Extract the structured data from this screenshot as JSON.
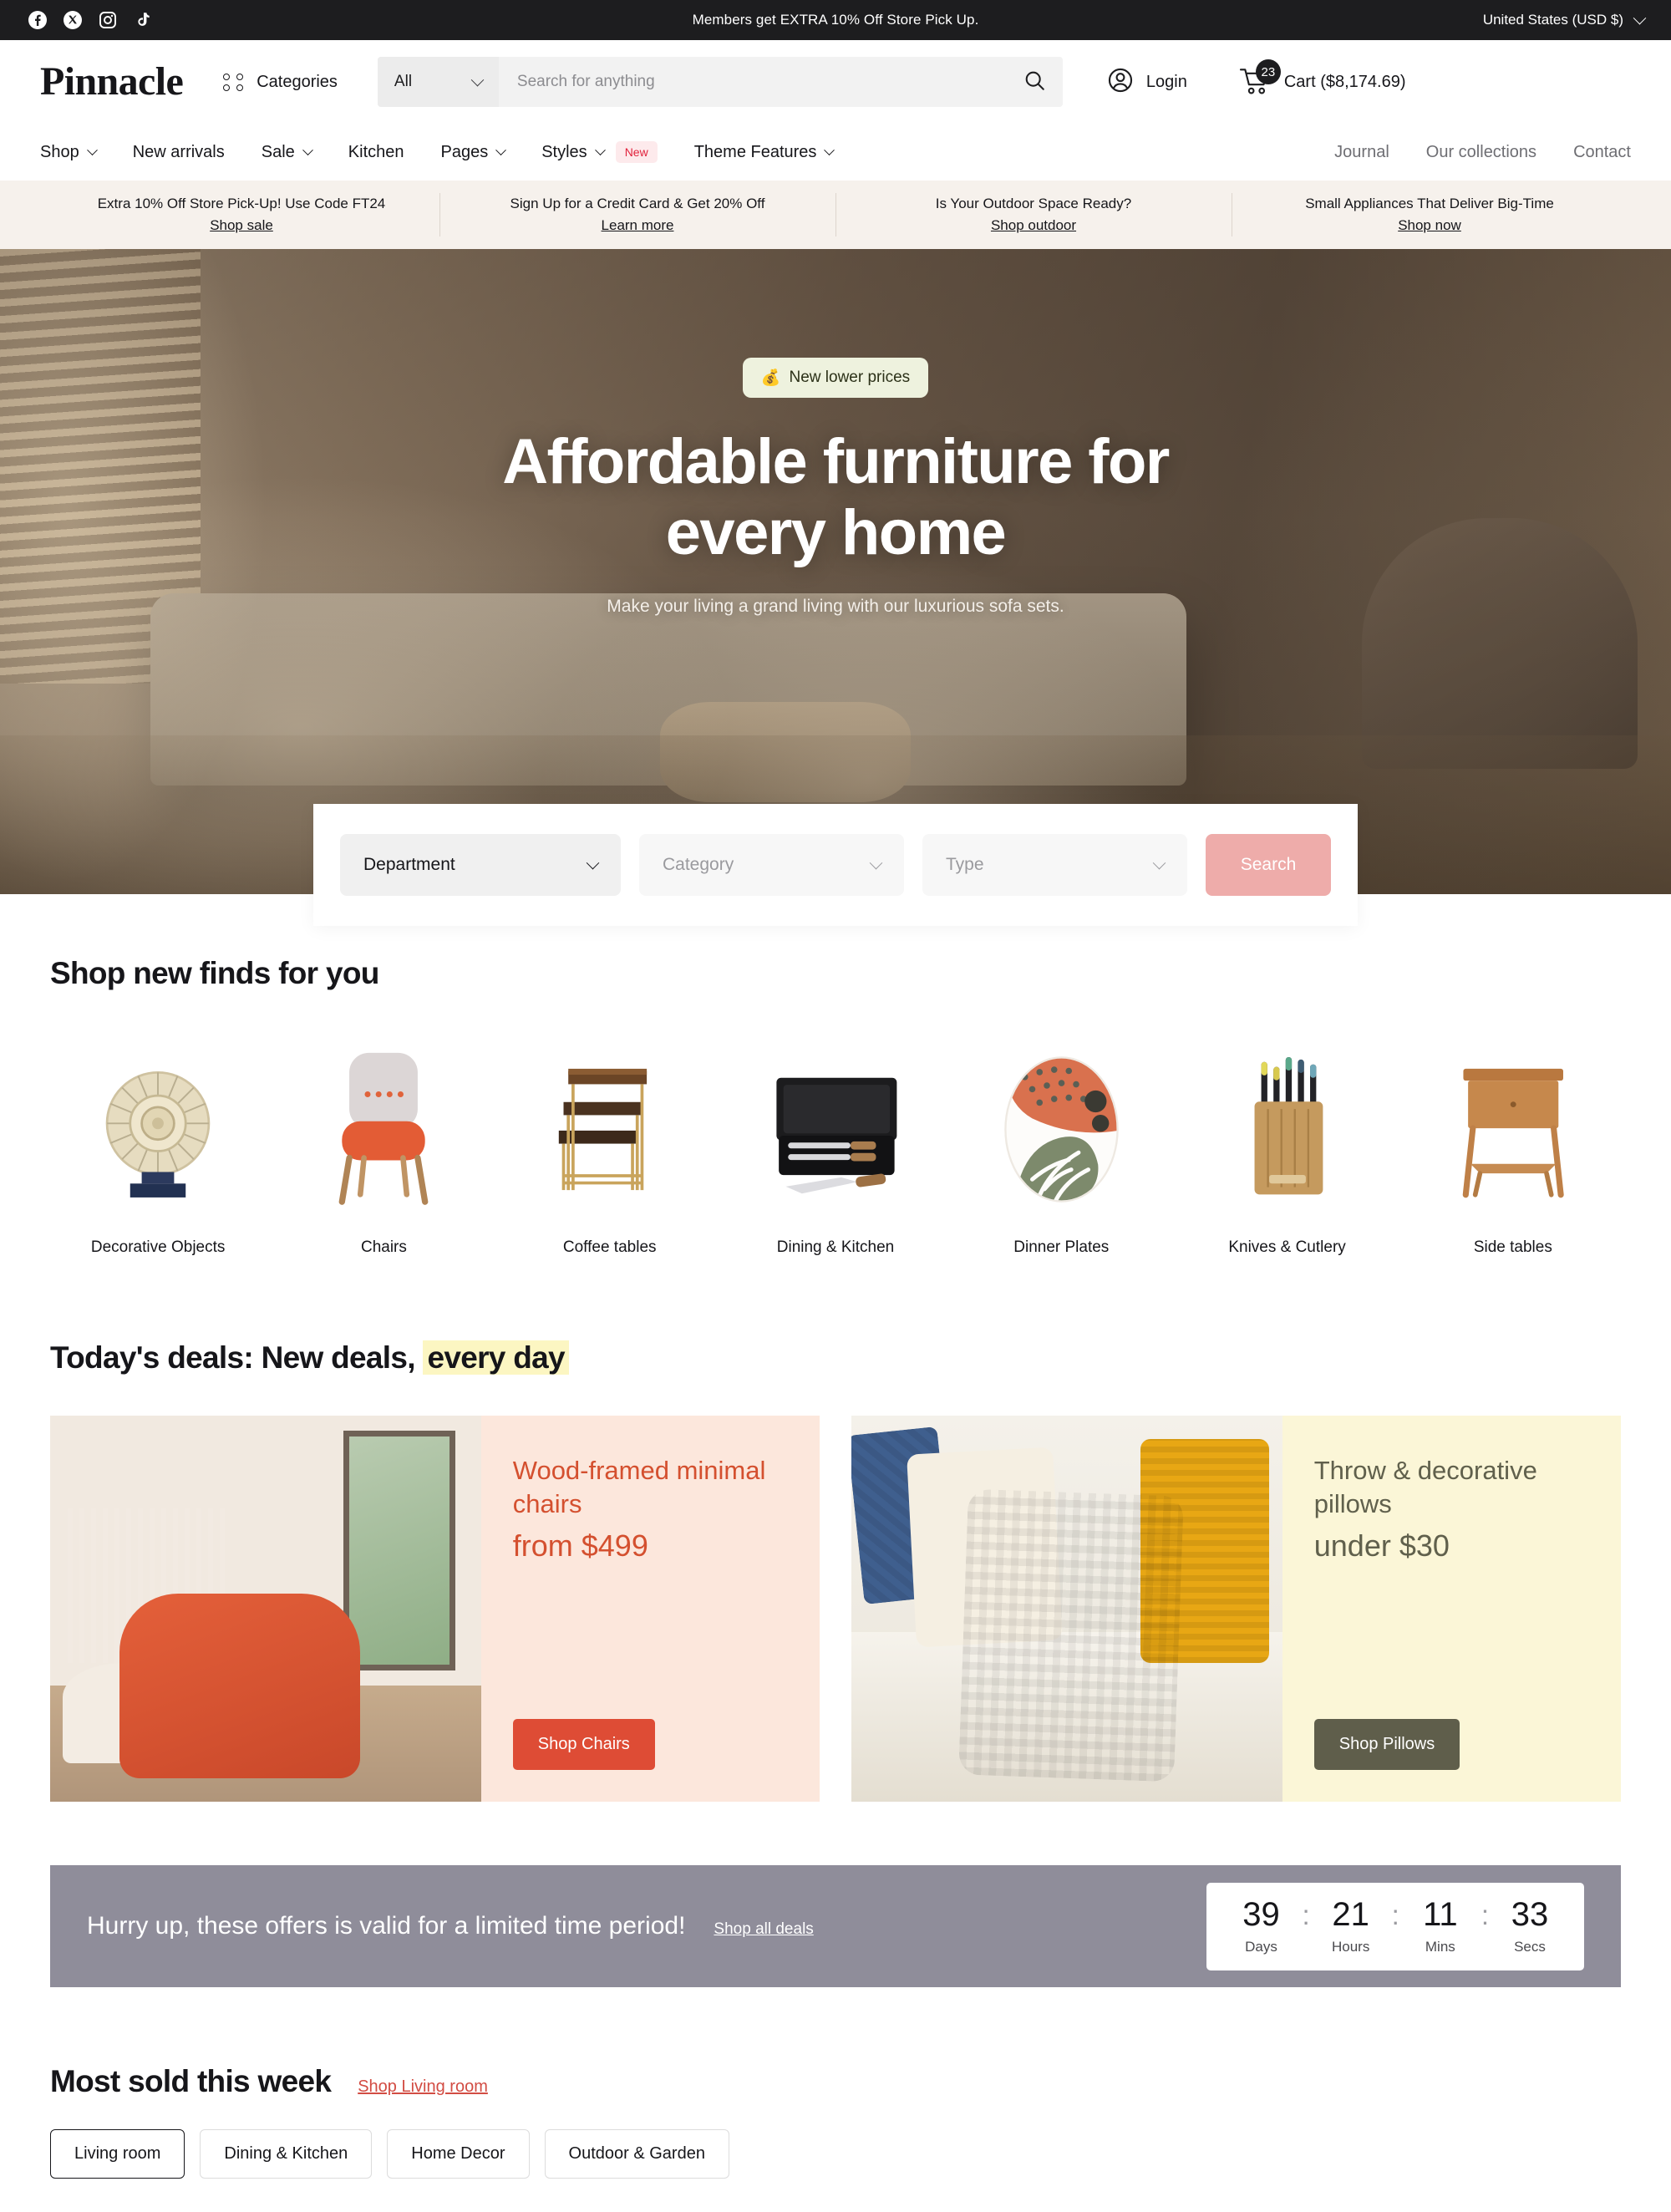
{
  "topbar": {
    "social": [
      {
        "name": "facebook-icon",
        "label": "Facebook"
      },
      {
        "name": "x-icon",
        "label": "X"
      },
      {
        "name": "instagram-icon",
        "label": "Instagram"
      },
      {
        "name": "tiktok-icon",
        "label": "TikTok"
      }
    ],
    "message": "Members get EXTRA 10% Off Store Pick Up.",
    "region": "United States (USD $)"
  },
  "header": {
    "logo": "Pinnacle",
    "categories_label": "Categories",
    "search": {
      "scope": "All",
      "placeholder": "Search for anything",
      "value": ""
    },
    "login_label": "Login",
    "cart_label": "Cart ($8,174.69)",
    "cart_count": "23"
  },
  "nav": {
    "left": [
      {
        "label": "Shop",
        "caret": true,
        "badge": ""
      },
      {
        "label": "New arrivals",
        "caret": false,
        "badge": ""
      },
      {
        "label": "Sale",
        "caret": true,
        "badge": ""
      },
      {
        "label": "Kitchen",
        "caret": false,
        "badge": ""
      },
      {
        "label": "Pages",
        "caret": true,
        "badge": ""
      },
      {
        "label": "Styles",
        "caret": true,
        "badge": "New"
      },
      {
        "label": "Theme Features",
        "caret": true,
        "badge": ""
      }
    ],
    "right": [
      {
        "label": "Journal"
      },
      {
        "label": "Our collections"
      },
      {
        "label": "Contact"
      }
    ]
  },
  "promos": [
    {
      "title": "Extra 10% Off Store Pick-Up! Use Code FT24",
      "link": "Shop sale"
    },
    {
      "title": "Sign Up for a Credit Card & Get 20% Off",
      "link": "Learn more"
    },
    {
      "title": "Is Your Outdoor Space Ready?",
      "link": "Shop outdoor"
    },
    {
      "title": "Small Appliances That Deliver Big-Time",
      "link": "Shop now"
    }
  ],
  "hero": {
    "badge_icon": "money-bag-icon",
    "badge": "New lower prices",
    "title_line1": "Affordable furniture for",
    "title_line2": "every home",
    "subtitle": "Make your living a grand living with our luxurious sofa sets."
  },
  "filter": {
    "department": "Department",
    "category": "Category",
    "type": "Type",
    "search_button": "Search"
  },
  "finds": {
    "heading": "Shop new finds for you",
    "tiles": [
      {
        "label": "Decorative Objects",
        "icon": "ammonite-sculpture-icon"
      },
      {
        "label": "Chairs",
        "icon": "upholstered-chair-icon"
      },
      {
        "label": "Coffee tables",
        "icon": "nesting-tables-icon"
      },
      {
        "label": "Dining & Kitchen",
        "icon": "knife-case-icon"
      },
      {
        "label": "Dinner Plates",
        "icon": "patterned-plate-icon"
      },
      {
        "label": "Knives & Cutlery",
        "icon": "knife-block-icon"
      },
      {
        "label": "Side tables",
        "icon": "side-table-icon"
      }
    ]
  },
  "deals": {
    "heading_plain": "Today's deals: New deals,",
    "heading_highlight": "every day",
    "cards": [
      {
        "title": "Wood-framed minimal chairs",
        "price": "from $499",
        "button": "Shop Chairs",
        "image": "orange-armchair-room-photo",
        "accent": "#DE4C35",
        "bg": "#FCE7DC"
      },
      {
        "title": "Throw & decorative pillows",
        "price": "under $30",
        "button": "Shop Pillows",
        "image": "gold-throw-pillows-photo",
        "accent": "#5F5E4B",
        "bg": "#FBF6D7"
      }
    ]
  },
  "countdown": {
    "message": "Hurry up, these offers is valid for a limited time period!",
    "link": "Shop all deals",
    "units": [
      {
        "value": "39",
        "label": "Days"
      },
      {
        "value": "21",
        "label": "Hours"
      },
      {
        "value": "11",
        "label": "Mins"
      },
      {
        "value": "33",
        "label": "Secs"
      }
    ],
    "separator": ":"
  },
  "most_sold": {
    "heading": "Most sold this week",
    "link": "Shop Living room",
    "tabs": [
      {
        "label": "Living room",
        "active": true
      },
      {
        "label": "Dining & Kitchen",
        "active": false
      },
      {
        "label": "Home Decor",
        "active": false
      },
      {
        "label": "Outdoor & Garden",
        "active": false
      }
    ]
  }
}
